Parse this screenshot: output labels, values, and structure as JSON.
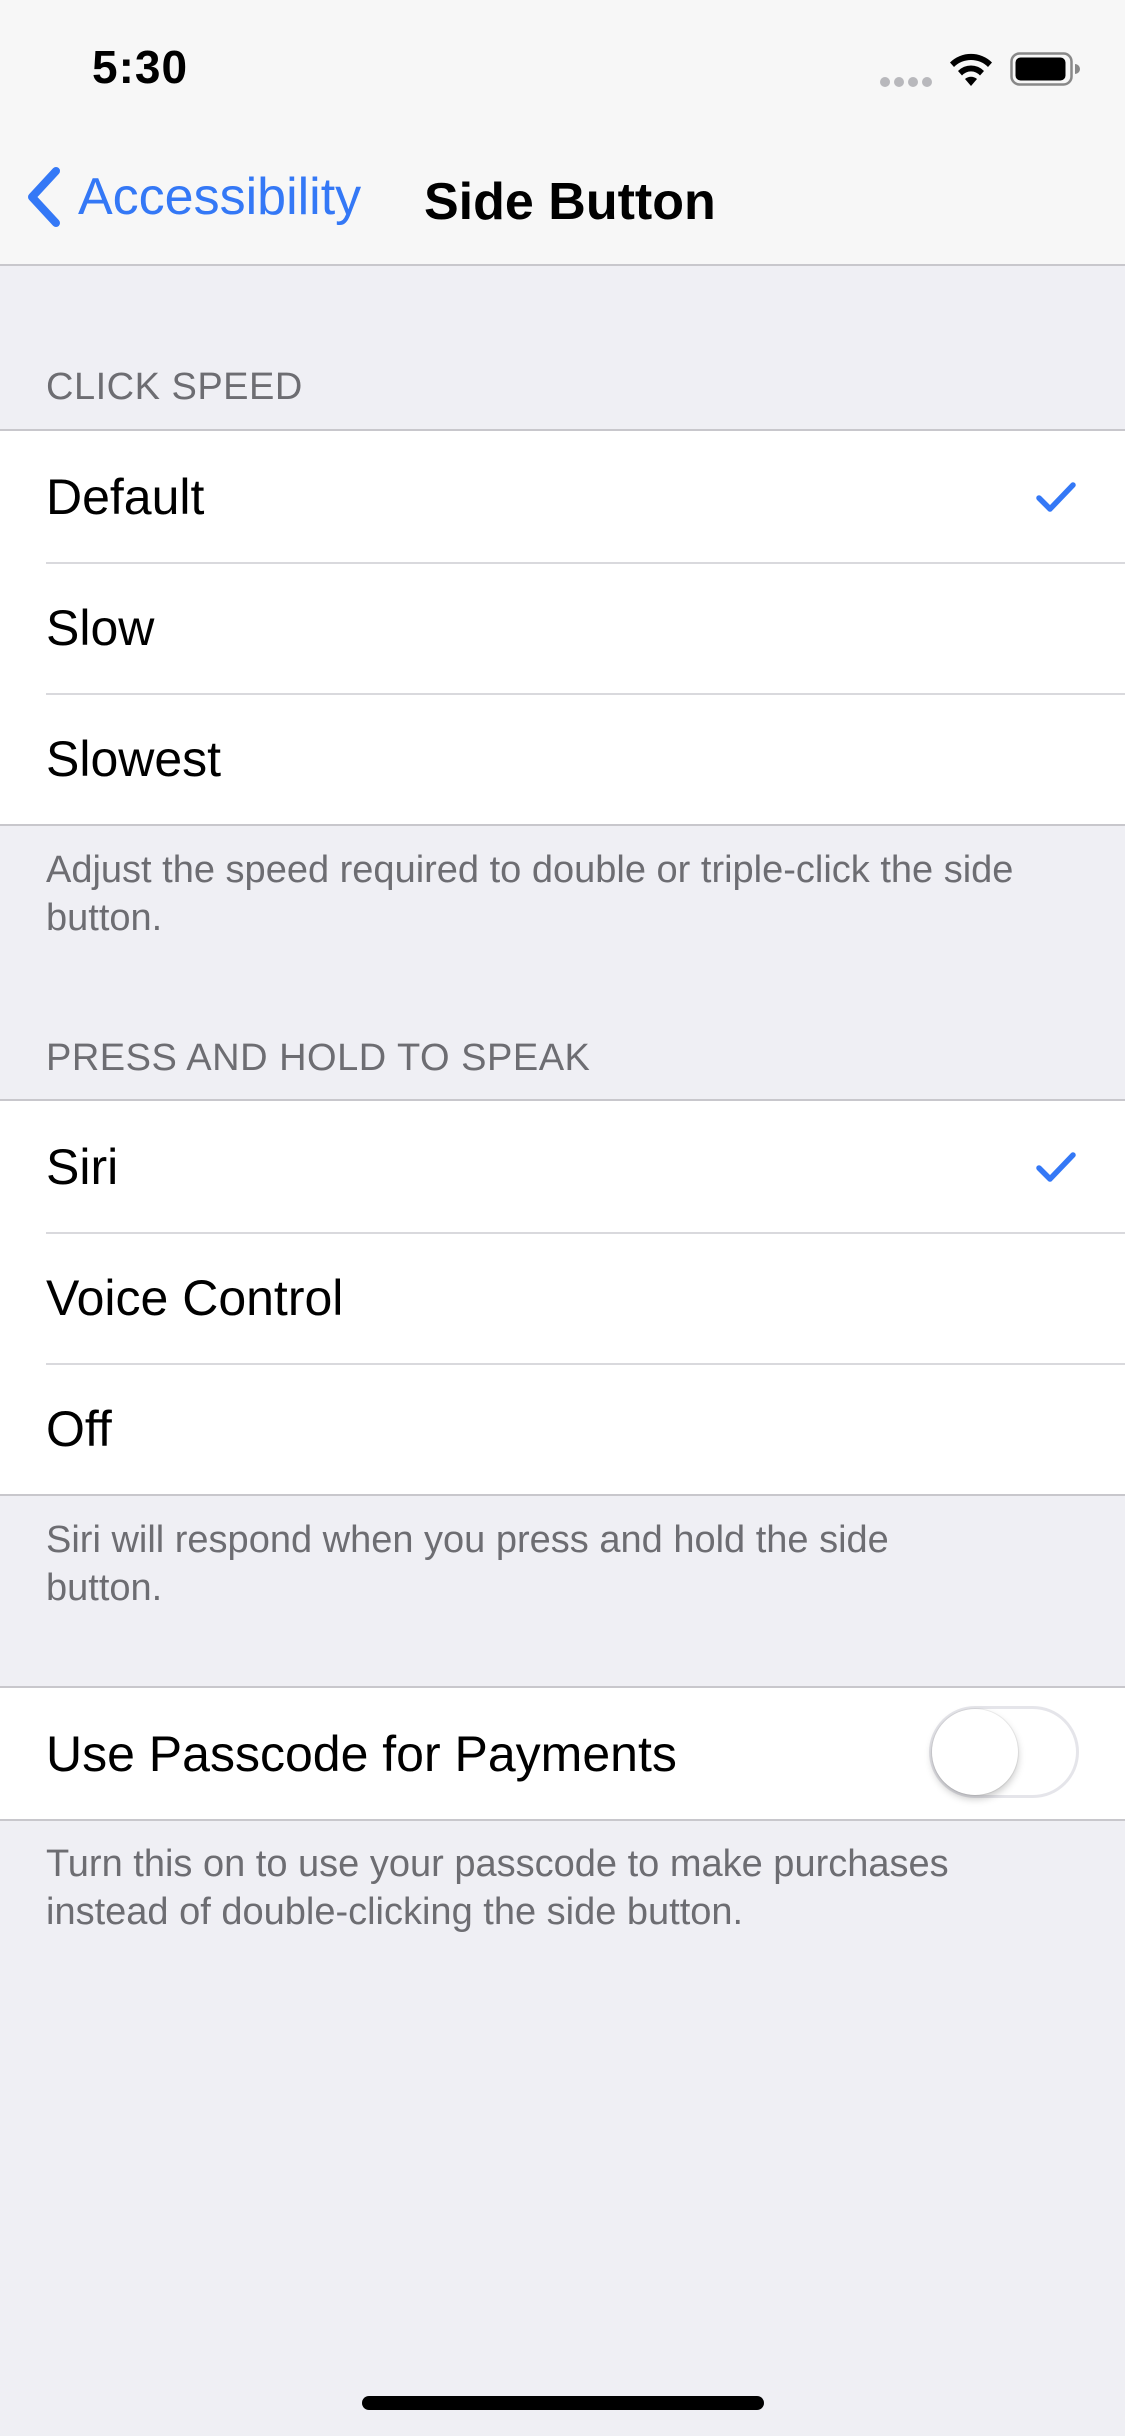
{
  "status_bar": {
    "time": "5:30",
    "icons": [
      "signal-dots-icon",
      "wifi-icon",
      "battery-icon"
    ]
  },
  "nav": {
    "back_label": "Accessibility",
    "title": "Side Button"
  },
  "click_speed": {
    "header": "CLICK SPEED",
    "options": [
      {
        "label": "Default",
        "selected": true
      },
      {
        "label": "Slow",
        "selected": false
      },
      {
        "label": "Slowest",
        "selected": false
      }
    ],
    "footer": "Adjust the speed required to double or triple-click the side button."
  },
  "press_hold": {
    "header": "PRESS AND HOLD TO SPEAK",
    "options": [
      {
        "label": "Siri",
        "selected": true
      },
      {
        "label": "Voice Control",
        "selected": false
      },
      {
        "label": "Off",
        "selected": false
      }
    ],
    "footer": "Siri will respond when you press and hold the side button."
  },
  "passcode": {
    "label": "Use Passcode for Payments",
    "enabled": false,
    "footer": "Turn this on to use your passcode to make purchases instead of double-clicking the side button."
  },
  "colors": {
    "accent": "#3478f6",
    "background": "#efeff4",
    "secondary_text": "#6d6d72",
    "separator": "#c8c7cc"
  }
}
